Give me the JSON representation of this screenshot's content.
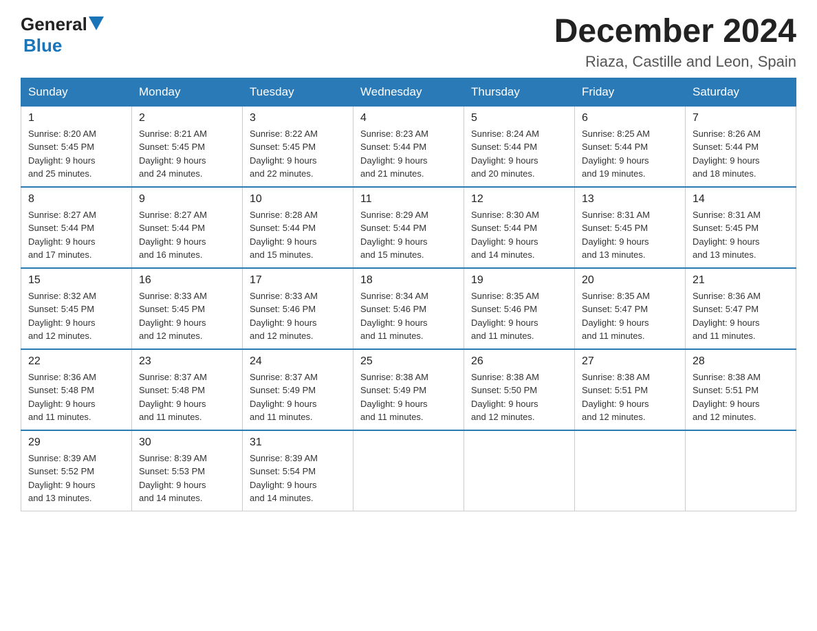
{
  "header": {
    "logo_general": "General",
    "logo_blue": "Blue",
    "month_title": "December 2024",
    "location": "Riaza, Castille and Leon, Spain"
  },
  "weekdays": [
    "Sunday",
    "Monday",
    "Tuesday",
    "Wednesday",
    "Thursday",
    "Friday",
    "Saturday"
  ],
  "weeks": [
    [
      {
        "day": "1",
        "sunrise": "8:20 AM",
        "sunset": "5:45 PM",
        "daylight": "9 hours and 25 minutes."
      },
      {
        "day": "2",
        "sunrise": "8:21 AM",
        "sunset": "5:45 PM",
        "daylight": "9 hours and 24 minutes."
      },
      {
        "day": "3",
        "sunrise": "8:22 AM",
        "sunset": "5:45 PM",
        "daylight": "9 hours and 22 minutes."
      },
      {
        "day": "4",
        "sunrise": "8:23 AM",
        "sunset": "5:44 PM",
        "daylight": "9 hours and 21 minutes."
      },
      {
        "day": "5",
        "sunrise": "8:24 AM",
        "sunset": "5:44 PM",
        "daylight": "9 hours and 20 minutes."
      },
      {
        "day": "6",
        "sunrise": "8:25 AM",
        "sunset": "5:44 PM",
        "daylight": "9 hours and 19 minutes."
      },
      {
        "day": "7",
        "sunrise": "8:26 AM",
        "sunset": "5:44 PM",
        "daylight": "9 hours and 18 minutes."
      }
    ],
    [
      {
        "day": "8",
        "sunrise": "8:27 AM",
        "sunset": "5:44 PM",
        "daylight": "9 hours and 17 minutes."
      },
      {
        "day": "9",
        "sunrise": "8:27 AM",
        "sunset": "5:44 PM",
        "daylight": "9 hours and 16 minutes."
      },
      {
        "day": "10",
        "sunrise": "8:28 AM",
        "sunset": "5:44 PM",
        "daylight": "9 hours and 15 minutes."
      },
      {
        "day": "11",
        "sunrise": "8:29 AM",
        "sunset": "5:44 PM",
        "daylight": "9 hours and 15 minutes."
      },
      {
        "day": "12",
        "sunrise": "8:30 AM",
        "sunset": "5:44 PM",
        "daylight": "9 hours and 14 minutes."
      },
      {
        "day": "13",
        "sunrise": "8:31 AM",
        "sunset": "5:45 PM",
        "daylight": "9 hours and 13 minutes."
      },
      {
        "day": "14",
        "sunrise": "8:31 AM",
        "sunset": "5:45 PM",
        "daylight": "9 hours and 13 minutes."
      }
    ],
    [
      {
        "day": "15",
        "sunrise": "8:32 AM",
        "sunset": "5:45 PM",
        "daylight": "9 hours and 12 minutes."
      },
      {
        "day": "16",
        "sunrise": "8:33 AM",
        "sunset": "5:45 PM",
        "daylight": "9 hours and 12 minutes."
      },
      {
        "day": "17",
        "sunrise": "8:33 AM",
        "sunset": "5:46 PM",
        "daylight": "9 hours and 12 minutes."
      },
      {
        "day": "18",
        "sunrise": "8:34 AM",
        "sunset": "5:46 PM",
        "daylight": "9 hours and 11 minutes."
      },
      {
        "day": "19",
        "sunrise": "8:35 AM",
        "sunset": "5:46 PM",
        "daylight": "9 hours and 11 minutes."
      },
      {
        "day": "20",
        "sunrise": "8:35 AM",
        "sunset": "5:47 PM",
        "daylight": "9 hours and 11 minutes."
      },
      {
        "day": "21",
        "sunrise": "8:36 AM",
        "sunset": "5:47 PM",
        "daylight": "9 hours and 11 minutes."
      }
    ],
    [
      {
        "day": "22",
        "sunrise": "8:36 AM",
        "sunset": "5:48 PM",
        "daylight": "9 hours and 11 minutes."
      },
      {
        "day": "23",
        "sunrise": "8:37 AM",
        "sunset": "5:48 PM",
        "daylight": "9 hours and 11 minutes."
      },
      {
        "day": "24",
        "sunrise": "8:37 AM",
        "sunset": "5:49 PM",
        "daylight": "9 hours and 11 minutes."
      },
      {
        "day": "25",
        "sunrise": "8:38 AM",
        "sunset": "5:49 PM",
        "daylight": "9 hours and 11 minutes."
      },
      {
        "day": "26",
        "sunrise": "8:38 AM",
        "sunset": "5:50 PM",
        "daylight": "9 hours and 12 minutes."
      },
      {
        "day": "27",
        "sunrise": "8:38 AM",
        "sunset": "5:51 PM",
        "daylight": "9 hours and 12 minutes."
      },
      {
        "day": "28",
        "sunrise": "8:38 AM",
        "sunset": "5:51 PM",
        "daylight": "9 hours and 12 minutes."
      }
    ],
    [
      {
        "day": "29",
        "sunrise": "8:39 AM",
        "sunset": "5:52 PM",
        "daylight": "9 hours and 13 minutes."
      },
      {
        "day": "30",
        "sunrise": "8:39 AM",
        "sunset": "5:53 PM",
        "daylight": "9 hours and 14 minutes."
      },
      {
        "day": "31",
        "sunrise": "8:39 AM",
        "sunset": "5:54 PM",
        "daylight": "9 hours and 14 minutes."
      },
      null,
      null,
      null,
      null
    ]
  ],
  "labels": {
    "sunrise": "Sunrise:",
    "sunset": "Sunset:",
    "daylight": "Daylight:"
  }
}
